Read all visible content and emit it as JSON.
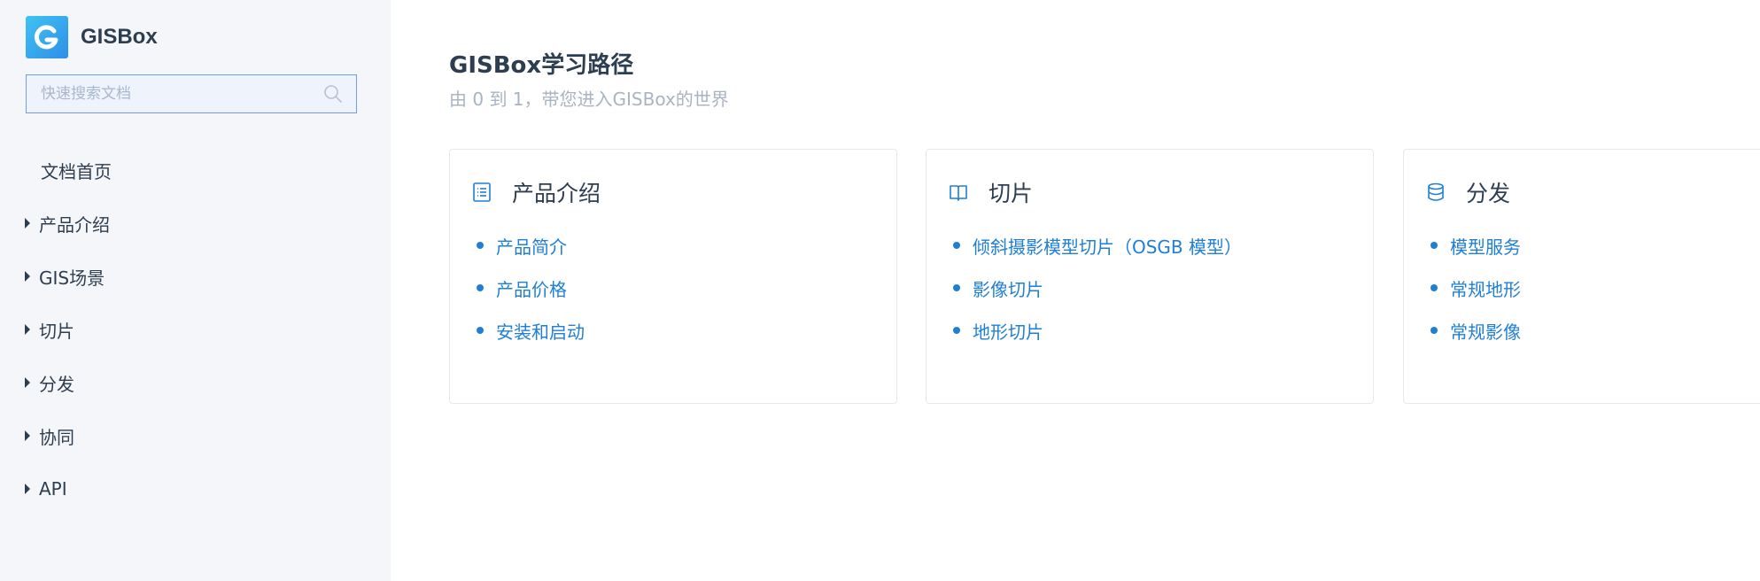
{
  "brand": {
    "name": "GISBox"
  },
  "search": {
    "placeholder": "快速搜索文档",
    "value": ""
  },
  "sidebar": {
    "items": [
      {
        "label": "文档首页",
        "expandable": false
      },
      {
        "label": "产品介绍",
        "expandable": true
      },
      {
        "label": "GIS场景",
        "expandable": true
      },
      {
        "label": "切片",
        "expandable": true
      },
      {
        "label": "分发",
        "expandable": true
      },
      {
        "label": "协同",
        "expandable": true
      },
      {
        "label": "API",
        "expandable": true
      }
    ]
  },
  "main": {
    "title": "GISBox学习路径",
    "subtitle": "由 0 到 1，带您进入GISBox的世界",
    "cards": [
      {
        "title": "产品介绍",
        "icon": "list-icon",
        "links": [
          "产品简介",
          "产品价格",
          "安装和启动"
        ]
      },
      {
        "title": "切片",
        "icon": "book-icon",
        "links": [
          "倾斜摄影模型切片（OSGB 模型）",
          "影像切片",
          "地形切片"
        ]
      },
      {
        "title": "分发",
        "icon": "database-icon",
        "links": [
          "模型服务",
          "常规地形",
          "常规影像"
        ]
      }
    ]
  },
  "colors": {
    "accent": "#1f7fd6",
    "sidebar_bg": "#f5f6fa",
    "text": "#2c3e50",
    "muted": "#a9b4c2"
  }
}
